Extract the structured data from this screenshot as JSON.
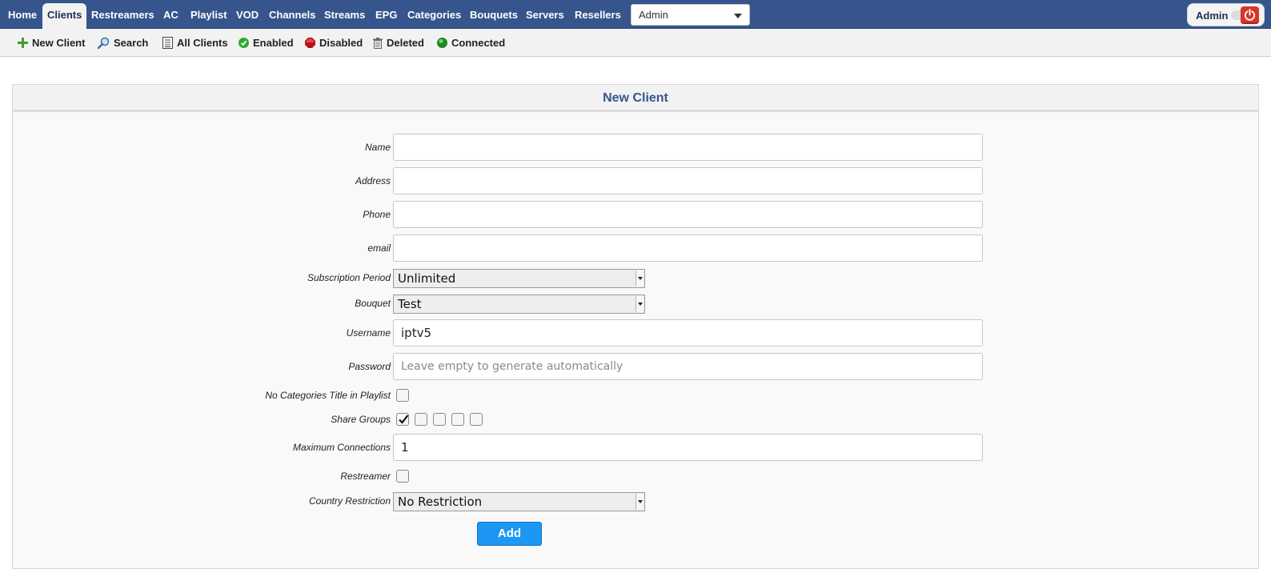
{
  "nav": {
    "items": [
      {
        "label": "Home"
      },
      {
        "label": "Clients"
      },
      {
        "label": "Restreamers"
      },
      {
        "label": "AC"
      },
      {
        "label": "Playlist"
      },
      {
        "label": "VOD"
      },
      {
        "label": "Channels"
      },
      {
        "label": "Streams"
      },
      {
        "label": "EPG"
      },
      {
        "label": "Categories"
      },
      {
        "label": "Bouquets"
      },
      {
        "label": "Servers"
      },
      {
        "label": "Resellers"
      }
    ],
    "active": "Clients",
    "role_select": {
      "value": "Admin"
    },
    "user": {
      "name": "Admin",
      "logout_icon": "power-icon"
    }
  },
  "toolbar": {
    "items": [
      {
        "label": "New Client",
        "icon": "plus-icon"
      },
      {
        "label": "Search",
        "icon": "magnifier-icon"
      },
      {
        "label": "All Clients",
        "icon": "list-icon"
      },
      {
        "label": "Enabled",
        "icon": "green-check-icon"
      },
      {
        "label": "Disabled",
        "icon": "red-stop-icon"
      },
      {
        "label": "Deleted",
        "icon": "trash-icon"
      },
      {
        "label": "Connected",
        "icon": "green-dot-icon"
      }
    ]
  },
  "form": {
    "title": "New Client",
    "name": {
      "label": "Name",
      "value": ""
    },
    "address": {
      "label": "Address",
      "value": ""
    },
    "phone": {
      "label": "Phone",
      "value": ""
    },
    "email": {
      "label": "email",
      "value": ""
    },
    "subscription_period": {
      "label": "Subscription Period",
      "value": "Unlimited"
    },
    "bouquet": {
      "label": "Bouquet",
      "value": "Test"
    },
    "username": {
      "label": "Username",
      "value": "iptv5"
    },
    "password": {
      "label": "Password",
      "value": "",
      "placeholder": "Leave empty to generate automatically"
    },
    "no_categories_title": {
      "label": "No Categories Title in Playlist",
      "checked": false
    },
    "share_groups": {
      "label": "Share Groups",
      "checked": [
        true,
        false,
        false,
        false,
        false
      ]
    },
    "max_connections": {
      "label": "Maximum Connections",
      "value": "1"
    },
    "restreamer": {
      "label": "Restreamer",
      "checked": false
    },
    "country_restriction": {
      "label": "Country Restriction",
      "value": "No Restriction"
    },
    "submit_label": "Add"
  },
  "colors": {
    "nav_bg": "#36558c",
    "title_color": "#36558c",
    "primary_button": "#1c97f3",
    "logout": "#d9342b"
  }
}
